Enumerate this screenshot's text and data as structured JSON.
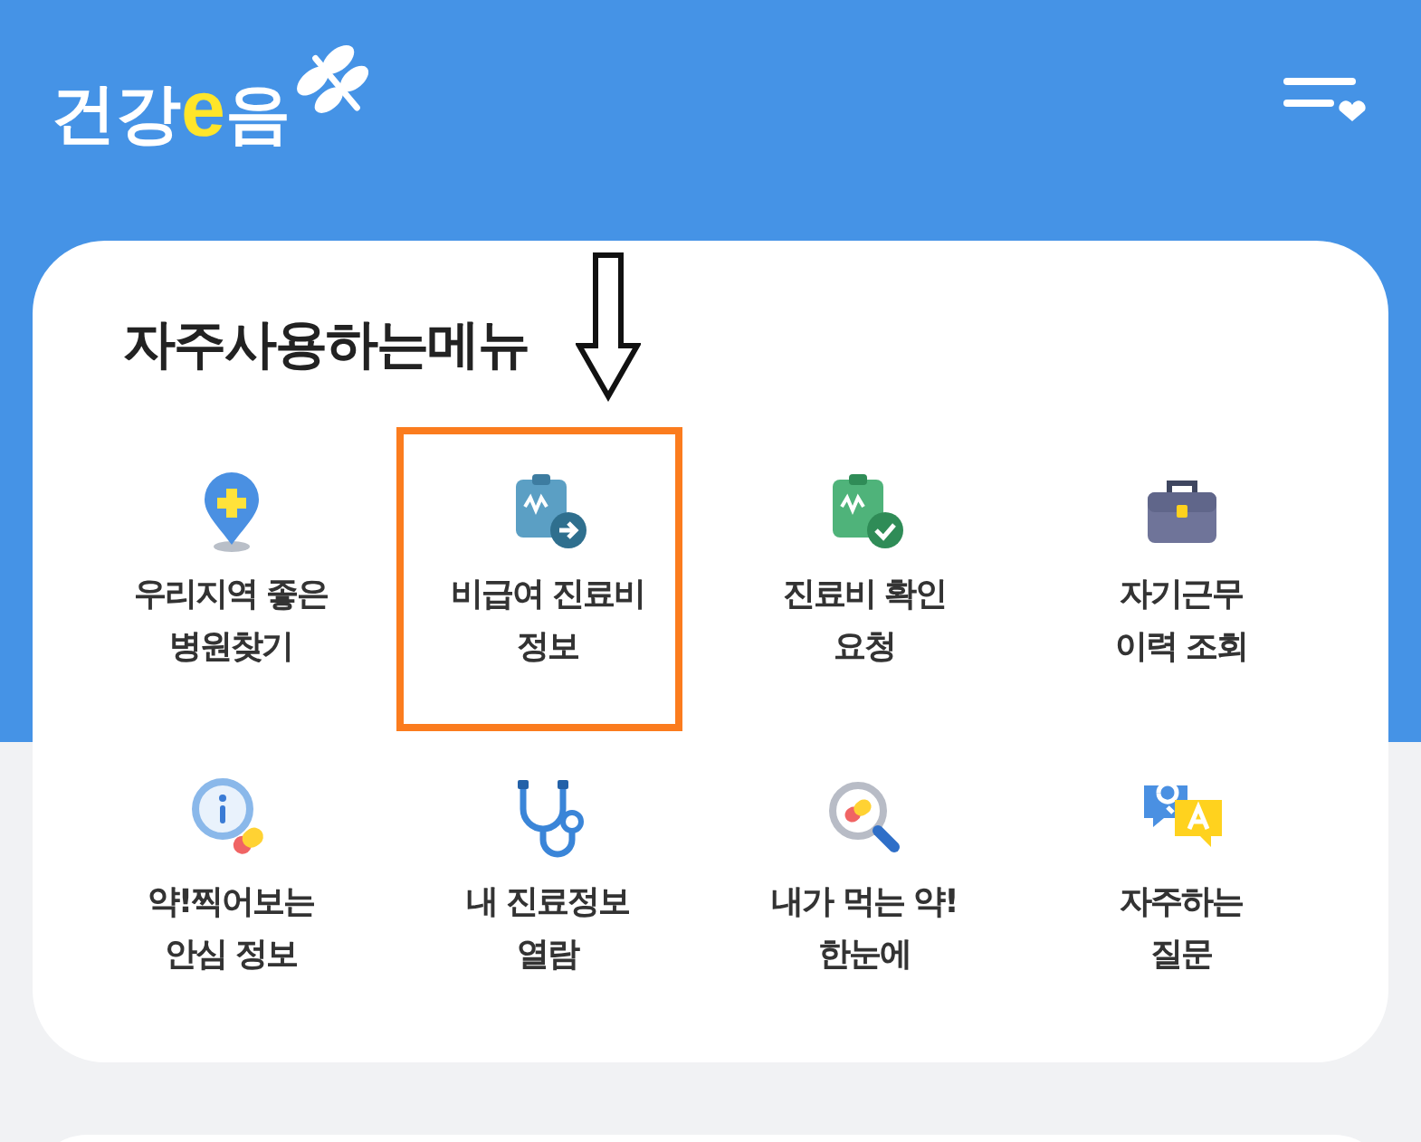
{
  "header": {
    "logo": [
      "건강",
      "e",
      "음"
    ]
  },
  "menu_card": {
    "title": "자주사용하는메뉴",
    "items": [
      {
        "label": "우리지역 좋은\n병원찾기",
        "kind": "pin",
        "highlighted": false
      },
      {
        "label": "비급여 진료비\n정보",
        "kind": "clipboard-arrow",
        "highlighted": true
      },
      {
        "label": "진료비 확인\n요청",
        "kind": "clipboard-check",
        "highlighted": false
      },
      {
        "label": "자기근무\n이력 조회",
        "kind": "briefcase",
        "highlighted": false
      },
      {
        "label": "약!찍어보는\n안심 정보",
        "kind": "info-pill",
        "highlighted": false
      },
      {
        "label": "내 진료정보\n열람",
        "kind": "stethoscope",
        "highlighted": false
      },
      {
        "label": "내가 먹는 약!\n한눈에",
        "kind": "magnifier-pill",
        "highlighted": false
      },
      {
        "label": "자주하는\n질문",
        "kind": "qa",
        "highlighted": false
      }
    ]
  }
}
